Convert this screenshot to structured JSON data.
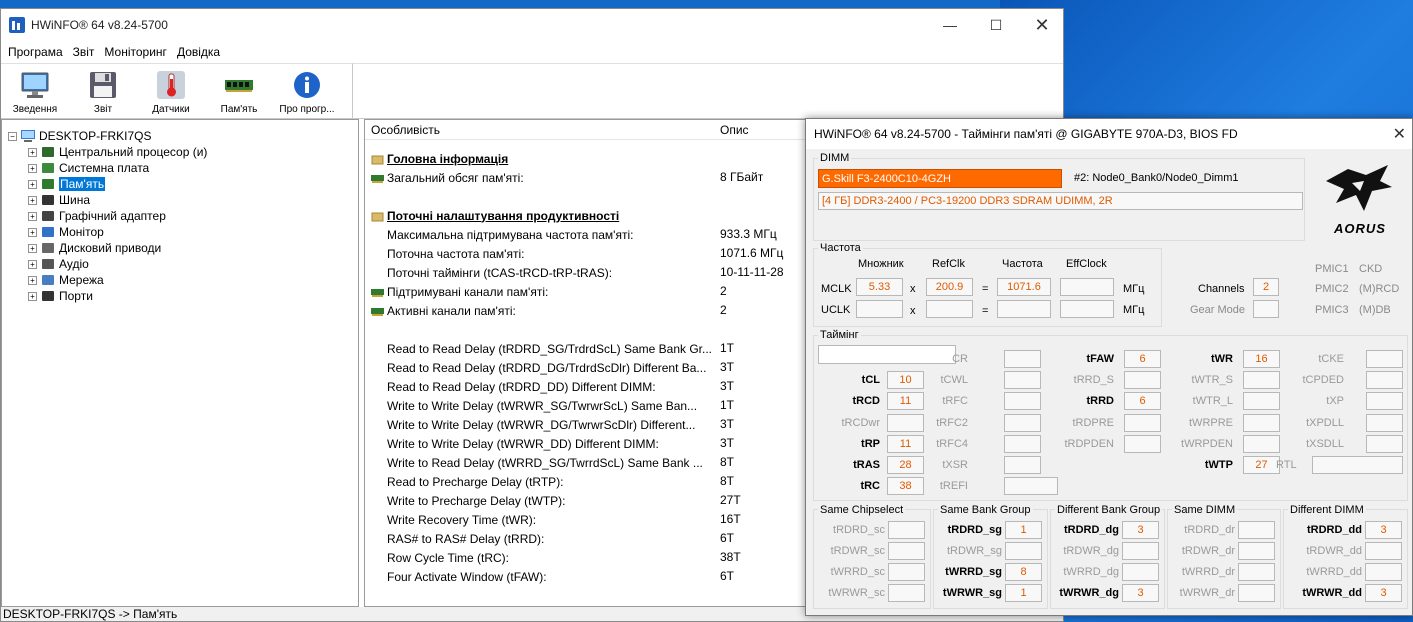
{
  "main": {
    "title": "HWiNFO® 64 v8.24-5700",
    "menu": [
      "Програма",
      "Звіт",
      "Моніторинг",
      "Довідка"
    ],
    "toolbar": [
      "Зведення",
      "Звіт",
      "Датчики",
      "Пам'ять",
      "Про прогр..."
    ],
    "tree": {
      "root": "DESKTOP-FRKI7QS",
      "items": [
        "Центральний процесор (и)",
        "Системна плата",
        "Пам'ять",
        "Шина",
        "Графічний адаптер",
        "Монітор",
        "Дисковий приводи",
        "Аудіо",
        "Мережа",
        "Порти"
      ],
      "selected_index": 2
    },
    "detail": {
      "col_feature": "Особливість",
      "col_desc": "Опис",
      "rows": [
        {
          "label": "Головна інформація",
          "value": "",
          "type": "section"
        },
        {
          "label": "Загальний обсяг пам'яті:",
          "value": "8 ГБайт",
          "type": "icon"
        },
        {
          "label": "",
          "value": "",
          "type": "blank"
        },
        {
          "label": "Поточні налаштування продуктивності",
          "value": "",
          "type": "section"
        },
        {
          "label": "Максимальна підтримувана частота пам'яті:",
          "value": "933.3 МГц",
          "type": "text"
        },
        {
          "label": "Поточна частота пам'яті:",
          "value": "1071.6 МГц",
          "type": "text"
        },
        {
          "label": "Поточні таймінги (tCAS-tRCD-tRP-tRAS):",
          "value": "10-11-11-28",
          "type": "text"
        },
        {
          "label": "Підтримувані канали пам'яті:",
          "value": "2",
          "type": "icon"
        },
        {
          "label": "Активні канали пам'яті:",
          "value": "2",
          "type": "icon"
        },
        {
          "label": "",
          "value": "",
          "type": "blank"
        },
        {
          "label": "Read to Read Delay (tRDRD_SG/TrdrdScL) Same Bank Gr...",
          "value": "1T",
          "type": "text"
        },
        {
          "label": "Read to Read Delay (tRDRD_DG/TrdrdScDlr) Different Ba...",
          "value": "3T",
          "type": "text"
        },
        {
          "label": "Read to Read Delay (tRDRD_DD) Different DIMM:",
          "value": "3T",
          "type": "text"
        },
        {
          "label": "Write to Write Delay (tWRWR_SG/TwrwrScL) Same Ban...",
          "value": "1T",
          "type": "text"
        },
        {
          "label": "Write to Write Delay (tWRWR_DG/TwrwrScDlr) Different...",
          "value": "3T",
          "type": "text"
        },
        {
          "label": "Write to Write Delay (tWRWR_DD) Different DIMM:",
          "value": "3T",
          "type": "text"
        },
        {
          "label": "Write to Read Delay (tWRRD_SG/TwrrdScL) Same Bank ...",
          "value": "8T",
          "type": "text"
        },
        {
          "label": "Read to Precharge Delay (tRTP):",
          "value": "8T",
          "type": "text"
        },
        {
          "label": "Write to Precharge Delay (tWTP):",
          "value": "27T",
          "type": "text"
        },
        {
          "label": "Write Recovery Time (tWR):",
          "value": "16T",
          "type": "text"
        },
        {
          "label": "RAS# to RAS# Delay (tRRD):",
          "value": "6T",
          "type": "text"
        },
        {
          "label": "Row Cycle Time (tRC):",
          "value": "38T",
          "type": "text"
        },
        {
          "label": "Four Activate Window (tFAW):",
          "value": "6T",
          "type": "text"
        }
      ]
    },
    "status": "DESKTOP-FRKI7QS -> Пам'ять"
  },
  "timings": {
    "title": "HWiNFO® 64 v8.24-5700 - Таймінги пам'яті @ GIGABYTE 970A-D3, BIOS FD",
    "dimm_label": "DIMM",
    "dimm_module": "G.Skill F3-2400C10-4GZH",
    "dimm_slot": "#2: Node0_Bank0/Node0_Dimm1",
    "dimm_desc": "[4 ГБ] DDR3-2400 / PC3-19200 DDR3 SDRAM UDIMM, 2R",
    "brand": "AORUS",
    "freq": {
      "label": "Частота",
      "h_mult": "Множник",
      "h_ref": "RefClk",
      "h_freq": "Частота",
      "h_eff": "EffClock",
      "mclk": "MCLK",
      "uclk": "UCLK",
      "x": "x",
      "eq": "=",
      "mclk_mult": "5.33",
      "mclk_ref": "200.9",
      "mclk_freq": "1071.6",
      "unit": "МГц"
    },
    "channels_label": "Channels",
    "channels": "2",
    "gear_label": "Gear Mode",
    "pmic": [
      [
        "PMIC1",
        "CKD"
      ],
      [
        "PMIC2",
        "(M)RCD"
      ],
      [
        "PMIC3",
        "(M)DB"
      ]
    ],
    "timing_label": "Таймінг",
    "t": {
      "tCL": "10",
      "tRCD": "11",
      "tRP": "11",
      "tRAS": "28",
      "tRC": "38",
      "tFAW": "6",
      "tRRD": "6",
      "tWR": "16",
      "tWTP": "27"
    },
    "names": {
      "c1": [
        "tCL",
        "tRCD",
        "tRCDwr",
        "tRP",
        "tRAS",
        "tRC"
      ],
      "c2": [
        "CR",
        "tCWL",
        "tRFC",
        "tRFC2",
        "tRFC4",
        "tXSR",
        "tREFI"
      ],
      "c3": [
        "tFAW",
        "tRRD_S",
        "tRRD",
        "tRDPRE",
        "tRDPDEN"
      ],
      "c4": [
        "tWR",
        "tWTR_S",
        "tWTR_L",
        "tWRPRE",
        "tWRPDEN",
        "tWTP"
      ],
      "c5": [
        "tCKE",
        "tCPDED",
        "tXP",
        "tXPDLL",
        "tXSDLL"
      ],
      "rtl": "RTL"
    },
    "groups": [
      {
        "title": "Same Chipselect",
        "rows": [
          [
            "tRDRD_sc",
            ""
          ],
          [
            "tRDWR_sc",
            ""
          ],
          [
            "tWRRD_sc",
            ""
          ],
          [
            "tWRWR_sc",
            ""
          ]
        ]
      },
      {
        "title": "Same Bank Group",
        "rows": [
          [
            "tRDRD_sg",
            "1"
          ],
          [
            "tRDWR_sg",
            ""
          ],
          [
            "tWRRD_sg",
            "8"
          ],
          [
            "tWRWR_sg",
            "1"
          ]
        ]
      },
      {
        "title": "Different Bank Group",
        "rows": [
          [
            "tRDRD_dg",
            "3"
          ],
          [
            "tRDWR_dg",
            ""
          ],
          [
            "tWRRD_dg",
            ""
          ],
          [
            "tWRWR_dg",
            "3"
          ]
        ]
      },
      {
        "title": "Same DIMM",
        "rows": [
          [
            "tRDRD_dr",
            ""
          ],
          [
            "tRDWR_dr",
            ""
          ],
          [
            "tWRRD_dr",
            ""
          ],
          [
            "tWRWR_dr",
            ""
          ]
        ]
      },
      {
        "title": "Different DIMM",
        "rows": [
          [
            "tRDRD_dd",
            "3"
          ],
          [
            "tRDWR_dd",
            ""
          ],
          [
            "tWRRD_dd",
            ""
          ],
          [
            "tWRWR_dd",
            "3"
          ]
        ]
      }
    ]
  }
}
